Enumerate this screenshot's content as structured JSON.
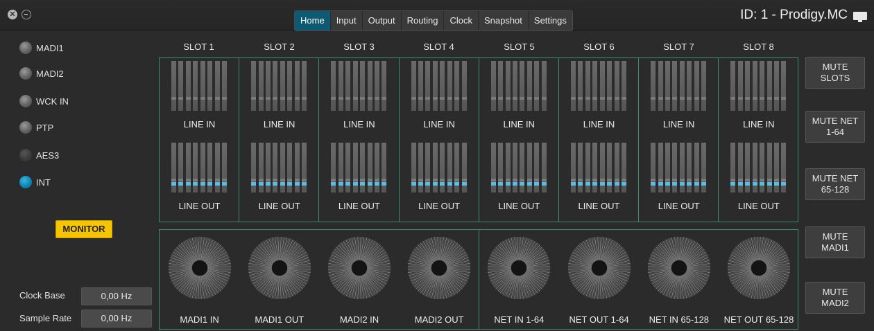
{
  "titlebar": {
    "close_glyph": "✕",
    "tabs": [
      "Home",
      "Input",
      "Output",
      "Routing",
      "Clock",
      "Snapshot",
      "Settings"
    ],
    "active_tab": "Home",
    "device_id": "ID: 1 - Prodigy.MC"
  },
  "sync_sources": [
    {
      "label": "MADI1",
      "state": "idle"
    },
    {
      "label": "MADI2",
      "state": "idle"
    },
    {
      "label": "WCK IN",
      "state": "idle"
    },
    {
      "label": "PTP",
      "state": "idle"
    },
    {
      "label": "AES3",
      "state": "off"
    },
    {
      "label": "INT",
      "state": "active"
    }
  ],
  "monitor_button": "MONITOR",
  "clock": {
    "clock_base_label": "Clock Base",
    "clock_base_value": "0,00 Hz",
    "sample_rate_label": "Sample Rate",
    "sample_rate_value": "0,00 Hz"
  },
  "slots": [
    {
      "title": "SLOT 1",
      "line_in": "LINE IN",
      "line_out": "LINE OUT"
    },
    {
      "title": "SLOT 2",
      "line_in": "LINE IN",
      "line_out": "LINE OUT"
    },
    {
      "title": "SLOT 3",
      "line_in": "LINE IN",
      "line_out": "LINE OUT"
    },
    {
      "title": "SLOT 4",
      "line_in": "LINE IN",
      "line_out": "LINE OUT"
    },
    {
      "title": "SLOT 5",
      "line_in": "LINE IN",
      "line_out": "LINE OUT"
    },
    {
      "title": "SLOT 6",
      "line_in": "LINE IN",
      "line_out": "LINE OUT"
    },
    {
      "title": "SLOT 7",
      "line_in": "LINE IN",
      "line_out": "LINE OUT"
    },
    {
      "title": "SLOT 8",
      "line_in": "LINE IN",
      "line_out": "LINE OUT"
    }
  ],
  "dials": [
    "MADI1 IN",
    "MADI1 OUT",
    "MADI2 IN",
    "MADI2 OUT",
    "NET IN 1-64",
    "NET OUT 1-64",
    "NET IN 65-128",
    "NET OUT 65-128"
  ],
  "mute_buttons": [
    {
      "line1": "MUTE",
      "line2": "SLOTS"
    },
    {
      "line1": "MUTE NET",
      "line2": "1-64"
    },
    {
      "line1": "MUTE NET",
      "line2": "65-128"
    },
    {
      "line1": "MUTE",
      "line2": "MADI1"
    },
    {
      "line1": "MUTE",
      "line2": "MADI2"
    }
  ],
  "colors": {
    "accent_tab": "#0e5a73",
    "led_active": "#0a86b6",
    "monitor_button": "#f6c400",
    "frame_border": "#3e8a77",
    "meter_signal": "#55bde6"
  }
}
